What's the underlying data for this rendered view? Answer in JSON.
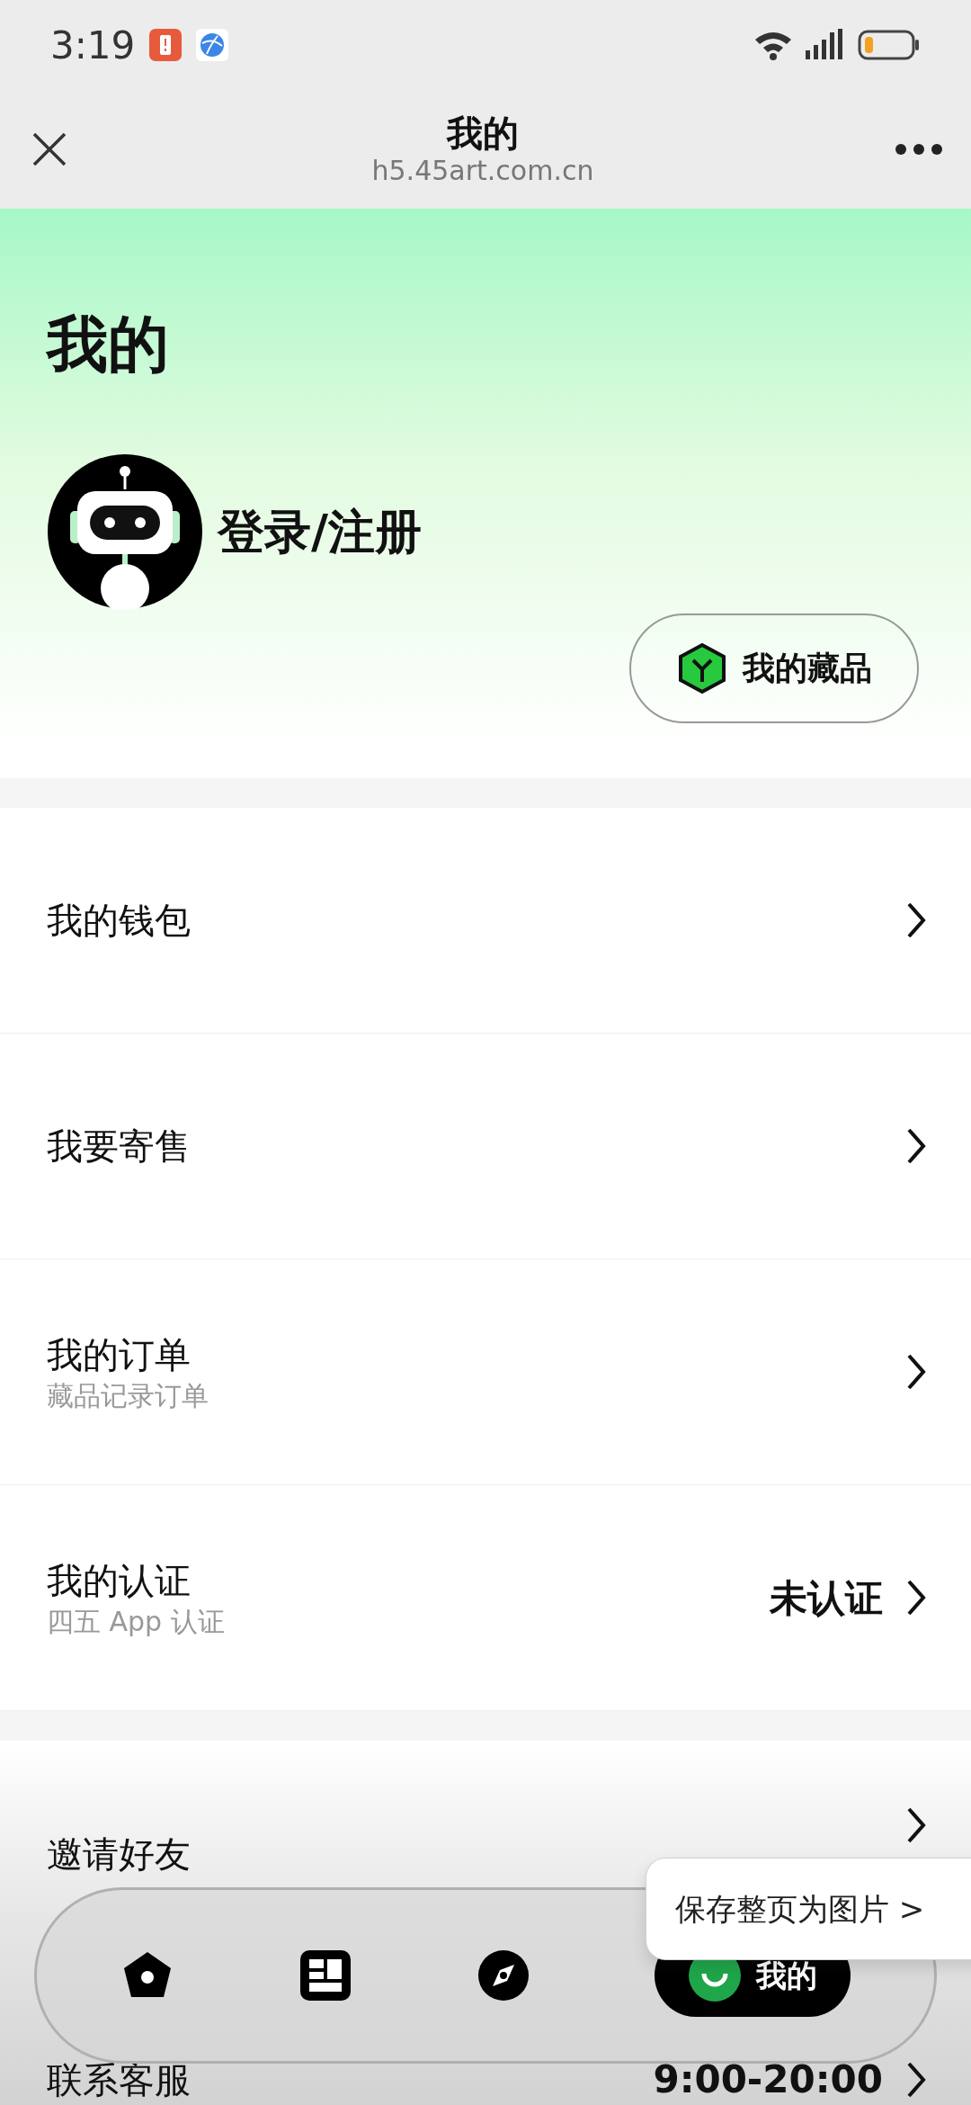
{
  "status_bar": {
    "time": "3:19"
  },
  "browser_bar": {
    "title": "我的",
    "url": "h5.45art.com.cn"
  },
  "profile": {
    "heading": "我的",
    "login": "登录/注册",
    "collection_button": "我的藏品"
  },
  "menu_groups": [
    [
      {
        "title": "我的钱包"
      },
      {
        "title": "我要寄售"
      },
      {
        "title": "我的订单",
        "subtitle": "藏品记录订单"
      },
      {
        "title": "我的认证",
        "subtitle": "四五 App 认证",
        "value": "未认证"
      }
    ],
    [
      {
        "title": "邀请好友"
      },
      {
        "title": "联系客服",
        "value": "9:00-20:00"
      }
    ]
  ],
  "tab_bar": {
    "tabs": [
      {
        "kind": "home",
        "selected": false
      },
      {
        "kind": "board",
        "selected": false
      },
      {
        "kind": "compass",
        "selected": false
      },
      {
        "kind": "me",
        "label": "我的",
        "selected": true
      }
    ]
  },
  "toast": {
    "text": "保存整页为图片 >"
  }
}
